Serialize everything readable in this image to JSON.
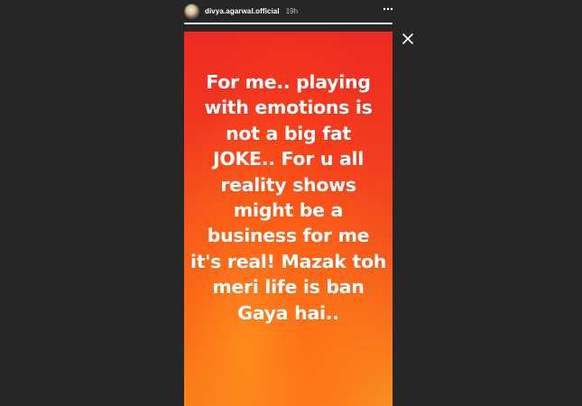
{
  "header": {
    "username": "divya.agarwal.official",
    "time": "19h",
    "avatar_icon": "profile-photo",
    "more_icon": "three-dots-horizontal"
  },
  "progress": {
    "fraction": 1.0
  },
  "story": {
    "lines": [
      "For me.. playing",
      "with emotions is",
      "not a big fat",
      "JOKE.. For u all",
      "reality shows",
      "might be a",
      "business for me",
      "it's real! Mazak toh",
      "meri life is ban",
      "Gaya hai.."
    ]
  },
  "controls": {
    "close_icon": "close-x"
  },
  "colors": {
    "background": "#262626",
    "story_top": "#ee2a22",
    "story_bottom": "#f59a25",
    "text": "#ffffff"
  }
}
